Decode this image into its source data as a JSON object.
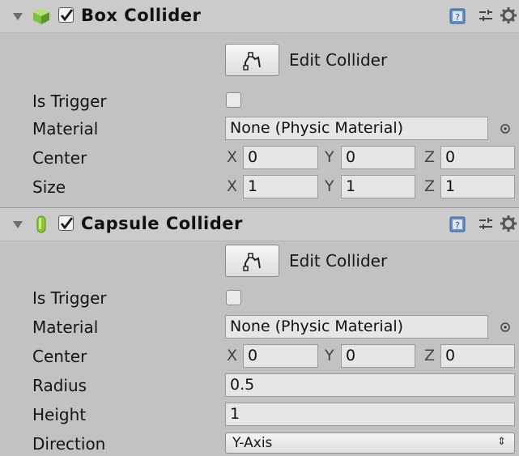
{
  "box_collider": {
    "title": "Box Collider",
    "enabled": true,
    "edit_collider_label": "Edit Collider",
    "is_trigger_label": "Is Trigger",
    "material_label": "Material",
    "material_value": "None (Physic Material)",
    "center_label": "Center",
    "center": {
      "x_label": "X",
      "x": "0",
      "y_label": "Y",
      "y": "0",
      "z_label": "Z",
      "z": "0"
    },
    "size_label": "Size",
    "size": {
      "x_label": "X",
      "x": "1",
      "y_label": "Y",
      "y": "1",
      "z_label": "Z",
      "z": "1"
    }
  },
  "capsule_collider": {
    "title": "Capsule Collider",
    "enabled": true,
    "edit_collider_label": "Edit Collider",
    "is_trigger_label": "Is Trigger",
    "material_label": "Material",
    "material_value": "None (Physic Material)",
    "center_label": "Center",
    "center": {
      "x_label": "X",
      "x": "0",
      "y_label": "Y",
      "y": "0",
      "z_label": "Z",
      "z": "0"
    },
    "radius_label": "Radius",
    "radius": "0.5",
    "height_label": "Height",
    "height": "1",
    "direction_label": "Direction",
    "direction": "Y-Axis"
  },
  "icons": {
    "foldout": "foldout-arrow-icon",
    "box_collider": "box-collider-icon",
    "capsule_collider": "capsule-collider-icon",
    "help": "help-icon",
    "preset": "preset-icon",
    "settings": "gear-icon",
    "edit_collider": "edit-collider-icon",
    "object_picker": "object-picker-icon"
  },
  "colors": {
    "background": "#c2c2c2",
    "header": "#cbcbcb",
    "field": "#e6e6e6",
    "box_icon": "#7fc243",
    "capsule_icon": "#8cc832"
  }
}
